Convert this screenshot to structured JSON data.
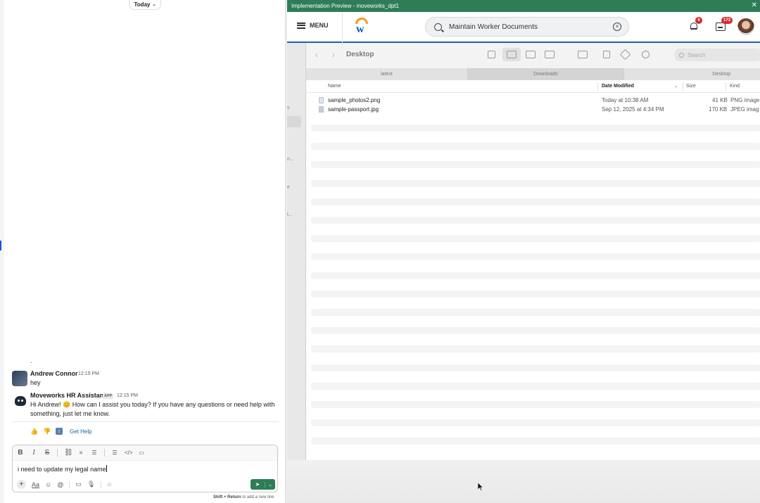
{
  "chat": {
    "date_divider": "Today",
    "separator": ".",
    "messages": [
      {
        "author": "Andrew Connor",
        "time": "12:15 PM",
        "text": "hey"
      },
      {
        "author": "Moveworks HR Assistant",
        "app_tag": "APP",
        "time": "12:15 PM",
        "text_line1": "Hi Andrew! 😊 How can I assist you today? If you have any questions or need help with",
        "text_line2": "something, just let me know."
      }
    ],
    "reactions": {
      "get_help": "Get Help"
    },
    "composer": {
      "value": "i need to update my legal name",
      "hint_key": "Shift + Return",
      "hint_text": "to add a new line"
    }
  },
  "preview": {
    "window_title": "Implementation Preview - moveworks_dpt1",
    "menu_label": "MENU",
    "search_value": "Maintain Worker Documents",
    "notifications_count": "6",
    "inbox_count": "173",
    "colors": {
      "titlebar": "#2e7d57",
      "badge": "#d42c2c",
      "brand_blue": "#005cb9"
    },
    "finder": {
      "title": "Desktop",
      "search_placeholder": "Search",
      "tabs": [
        "latest",
        "Downloads",
        "Desktop"
      ],
      "columns": {
        "name": "Name",
        "date": "Date Modified",
        "size": "Size",
        "kind": "Kind"
      },
      "files": [
        {
          "name": "sample_photos2.png",
          "date": "Today at 10:38 AM",
          "size": "41 KB",
          "kind": "PNG image"
        },
        {
          "name": "sample-passport.jpg",
          "date": "Sep 12, 2025 at 4:34 PM",
          "size": "170 KB",
          "kind": "JPEG imag"
        }
      ],
      "sidebar_fragments": [
        "s",
        "n...",
        "e",
        "t..."
      ]
    }
  }
}
